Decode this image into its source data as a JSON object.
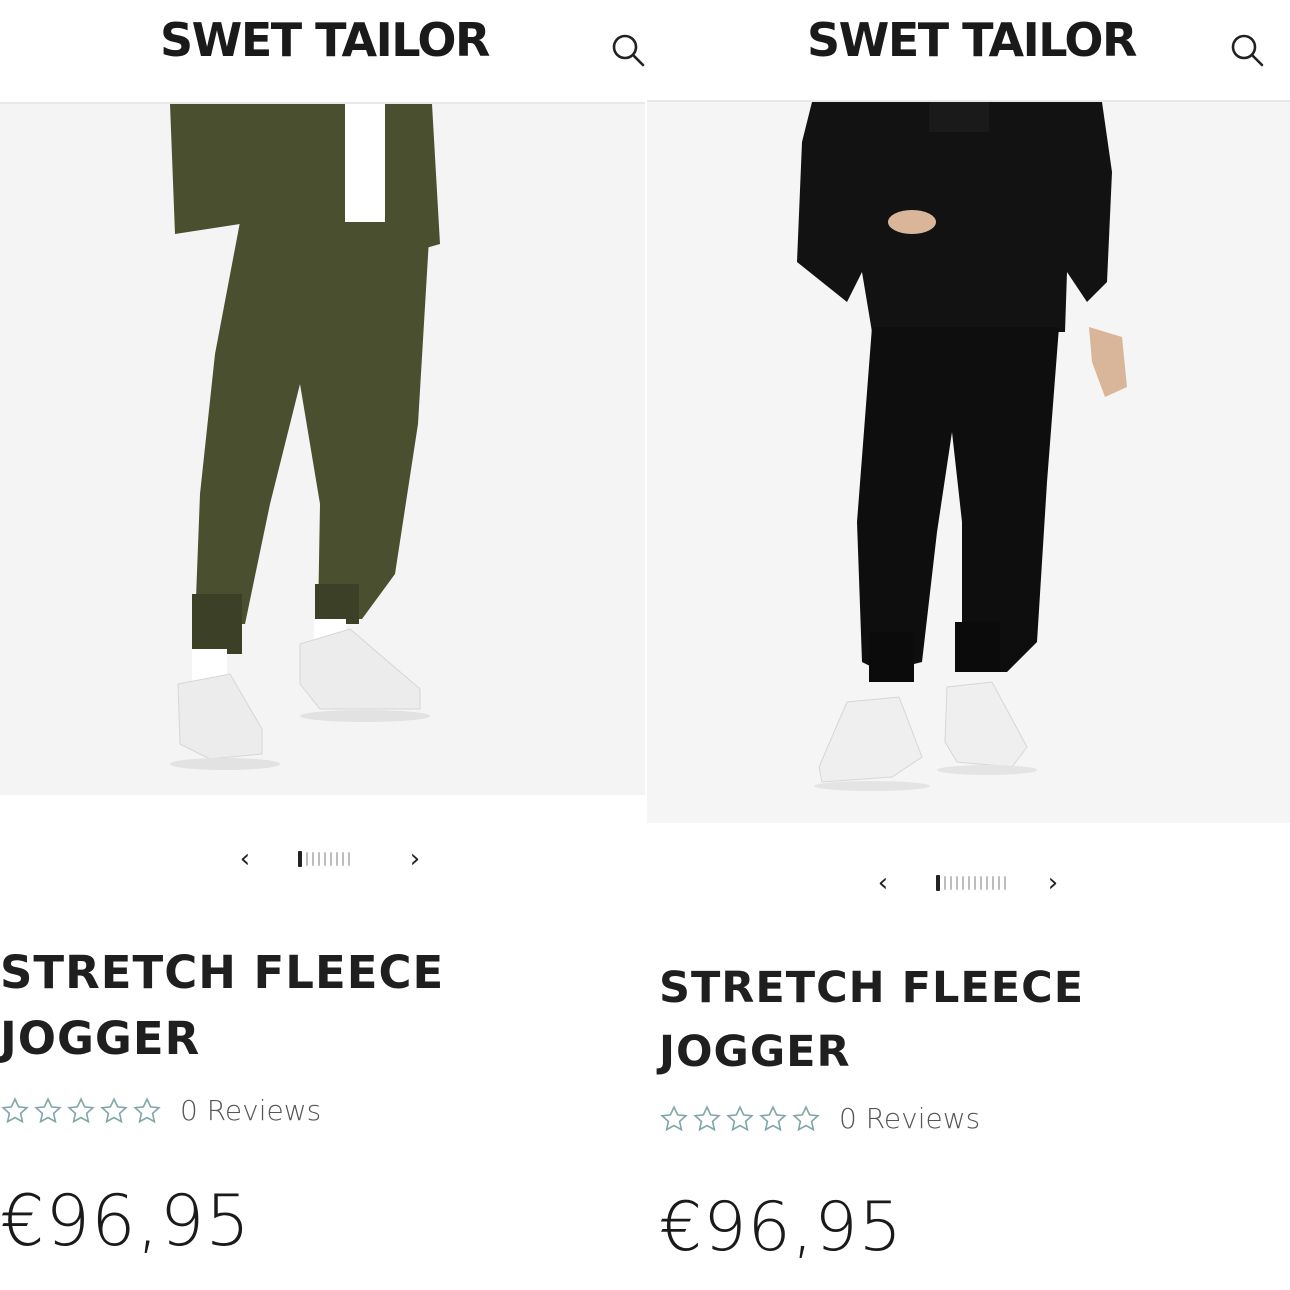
{
  "panels": [
    {
      "brand": "SWET TAILOR",
      "search_icon": "search-icon",
      "product_title_line1": "STRETCH FLEECE",
      "product_title_line2": "JOGGER",
      "rating_stars": 0,
      "reviews_label": "0 Reviews",
      "price": "€96,95",
      "carousel": {
        "prev_icon": "chevron-left-icon",
        "next_icon": "chevron-right-icon",
        "prev_label": "‹",
        "next_label": "›",
        "total_slides": 9,
        "active_slide": 1
      },
      "product_color": "#4a4f2f"
    },
    {
      "brand": "SWET TAILOR",
      "search_icon": "search-icon",
      "product_title_line1": "STRETCH FLEECE",
      "product_title_line2": "JOGGER",
      "rating_stars": 0,
      "reviews_label": "0 Reviews",
      "price": "€96,95",
      "carousel": {
        "prev_icon": "chevron-left-icon",
        "next_icon": "chevron-right-icon",
        "prev_label": "‹",
        "next_label": "›",
        "total_slides": 12,
        "active_slide": 1
      },
      "product_color": "#111111"
    }
  ],
  "colors": {
    "star_outline": "#7fa7a7",
    "text": "#1f1f1f",
    "accent_dot": "#222222"
  }
}
